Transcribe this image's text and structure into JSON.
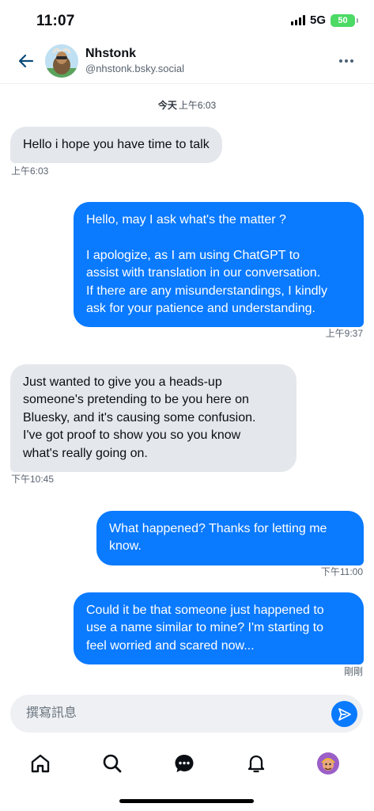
{
  "status": {
    "time": "11:07",
    "network": "5G",
    "battery": "50"
  },
  "header": {
    "name": "Nhstonk",
    "handle": "@nhstonk.bsky.social"
  },
  "day_separator": {
    "day": "今天",
    "time": "上午6:03"
  },
  "messages": [
    {
      "dir": "in",
      "lines": [
        "Hello i hope you have time to talk"
      ],
      "time": "上午6:03"
    },
    {
      "dir": "out",
      "lines": [
        "Hello, may I ask what's the matter ?",
        "",
        "I apologize, as I am using ChatGPT to",
        "assist with translation in our conversation.",
        "If there are any misunderstandings, I kindly",
        "ask for your patience and understanding."
      ],
      "time": "上午9:37"
    },
    {
      "dir": "in",
      "lines": [
        "Just wanted to give you a heads-up",
        "someone's pretending to be you here on",
        "Bluesky, and it's causing some confusion.",
        "I've got proof to show you so you know",
        "what's really going on."
      ],
      "time": "下午10:45"
    },
    {
      "dir": "out",
      "lines": [
        "What happened? Thanks for letting me",
        "know."
      ],
      "time": "下午11:00"
    },
    {
      "dir": "out",
      "lines": [
        "Could it be that someone just happened to",
        "use a name similar to mine? I'm starting to",
        "feel worried and scared now..."
      ],
      "time": "剛剛"
    }
  ],
  "composer": {
    "placeholder": "撰寫訊息"
  },
  "nav": [
    "home-icon",
    "search-icon",
    "chat-icon",
    "bell-icon",
    "profile-avatar"
  ]
}
